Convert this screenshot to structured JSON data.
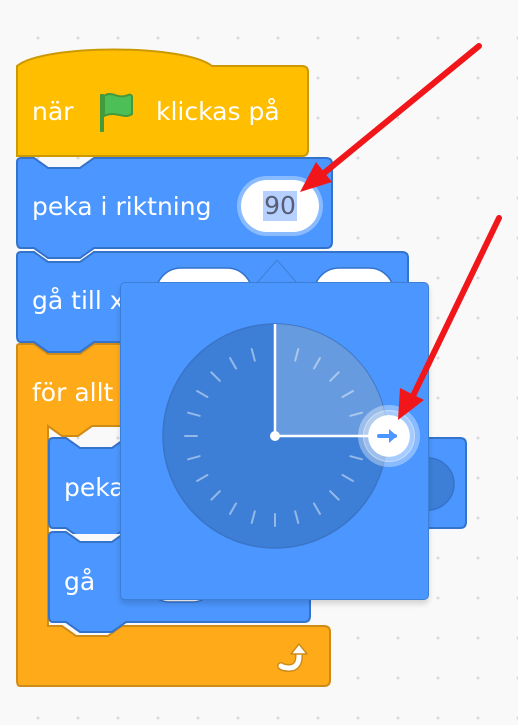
{
  "script": {
    "hat_block": {
      "before_flag": "när",
      "after_flag": "klickas på",
      "flag_icon": "green-flag-icon"
    },
    "point_block": {
      "label": "peka i riktning",
      "value": "90"
    },
    "goto_block": {
      "label": "gå till x"
    },
    "forever_block": {
      "label": "för allt"
    },
    "inner_point_block": {
      "label": "peka"
    },
    "move_block": {
      "label": "gå"
    },
    "loop_icon": "loop-arrow-icon"
  },
  "direction_dial": {
    "angle_degrees": 90,
    "handle_icon": "arrow-right-icon"
  },
  "annotations": {
    "arrow_color": "#f0161a",
    "arrows": [
      "arrow-to-direction-field",
      "arrow-to-dial-handle"
    ]
  },
  "colors": {
    "motion": "#4c97ff",
    "control": "#ffab19",
    "events": "#ffbf00",
    "dial_face": "#3d7fd6"
  }
}
